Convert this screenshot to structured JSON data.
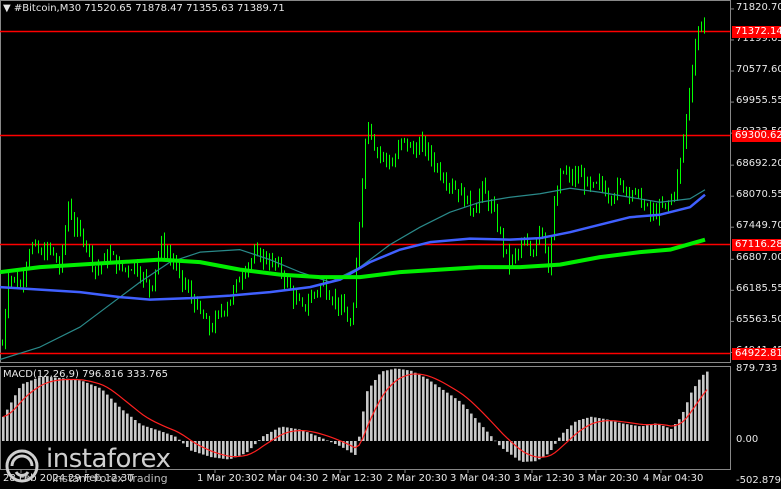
{
  "header": {
    "symbol": "#Bitcoin,M30",
    "open": "71520.65",
    "high": "71878.47",
    "low": "71355.63",
    "close": "71389.71"
  },
  "price_axis": [
    "71820.70",
    "71199.65",
    "70577.60",
    "69955.55",
    "69333.50",
    "68692.20",
    "68070.55",
    "67449.70",
    "66807.00",
    "66185.55",
    "65563.50",
    "64941.45"
  ],
  "levels": [
    {
      "label": "71372.14",
      "color": "#ff0000"
    },
    {
      "label": "69300.62",
      "color": "#ff0000"
    },
    {
      "label": "67116.28",
      "color": "#ff0000"
    },
    {
      "label": "64922.81",
      "color": "#ff0000"
    }
  ],
  "macd": {
    "label": "MACD(12,26,9) 796.816 333.765",
    "axis": [
      "879.733",
      "0.00",
      "-502.879"
    ]
  },
  "time_axis": [
    "28 Feb 2024",
    "29 Feb 12:30",
    "1 Mar 20:30",
    "2 Mar 04:30",
    "2 Mar 12:30",
    "2 Mar 20:30",
    "3 Mar 04:30",
    "3 Mar 12:30",
    "3 Mar 20:30",
    "4 Mar 04:30"
  ],
  "branding": {
    "name": "instaforex",
    "tagline": "Instant Forex Trading"
  },
  "colors": {
    "candles": "#00ff00",
    "ma_green": "#00ee00",
    "ma_blue": "#4060ff",
    "ma_teal": "#2a8a8a",
    "levels": "#ff0000",
    "macd_hist": "#c8c8c8",
    "macd_signal": "#ff2020"
  }
}
